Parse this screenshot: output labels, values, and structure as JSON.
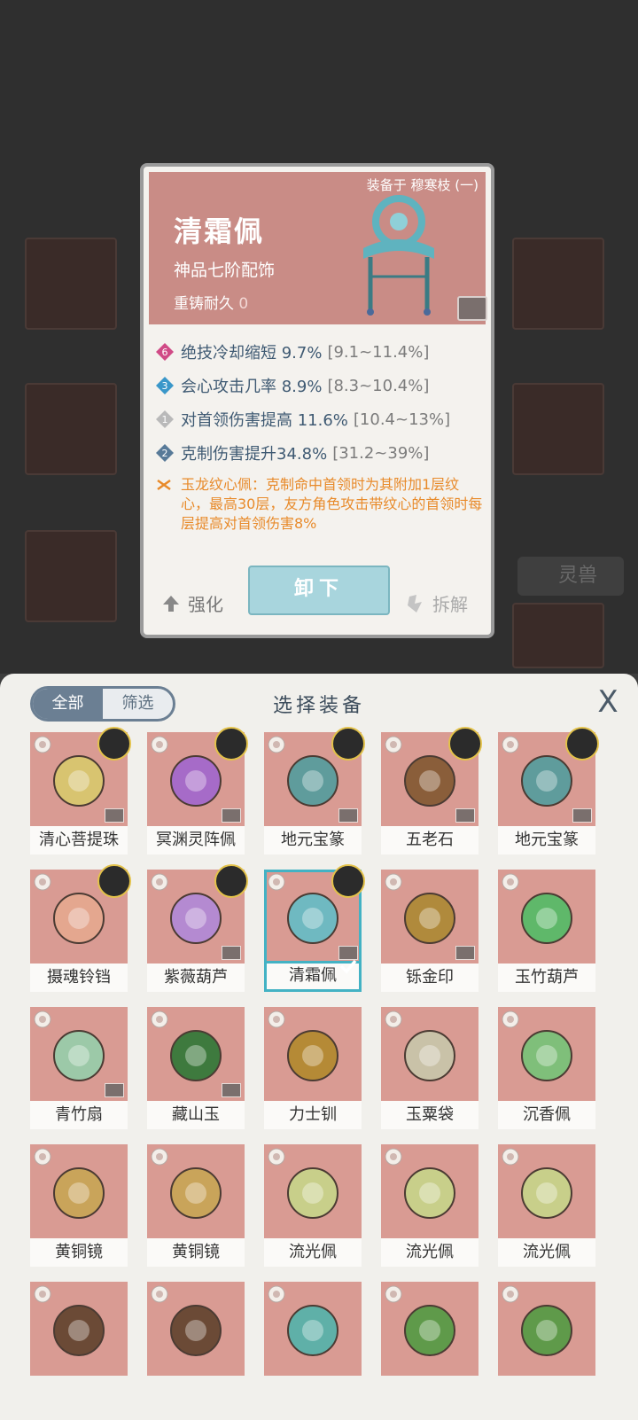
{
  "detail": {
    "equipped_on": "装备于 穆寒枝 (一)",
    "name": "清霜佩",
    "grade": "神品七阶配饰",
    "recast_label": "重铸耐久",
    "recast_value": "0",
    "stats": [
      {
        "badge": "6",
        "badge_color": "#d04a86",
        "text": "绝技冷却缩短 9.7%",
        "range": "[9.1~11.4%]"
      },
      {
        "badge": "3",
        "badge_color": "#3a97c9",
        "text": "会心攻击几率 8.9%",
        "range": "[8.3~10.4%]"
      },
      {
        "badge": "1",
        "badge_color": "#b9b9b9",
        "text": "对首领伤害提高 11.6%",
        "range": "[10.4~13%]"
      },
      {
        "badge": "2",
        "badge_color": "#587a98",
        "text": "克制伤害提升34.8%",
        "range": "[31.2~39%]"
      }
    ],
    "set_effect": "玉龙纹心佩：克制命中首领时为其附加1层纹心，最高30层，友方角色攻击带纹心的首领时每层提高对首领伤害8%",
    "strengthen_label": "强化",
    "unequip_label": "卸下",
    "dismantle_label": "拆解"
  },
  "background": {
    "tab_label": "灵兽"
  },
  "panel": {
    "tab_all": "全部",
    "tab_filter": "筛选",
    "title": "选择装备",
    "close_label": "X",
    "items": [
      {
        "name": "清心菩提珠",
        "color": "#d8c470",
        "avatar": true,
        "locked": true,
        "selected": false
      },
      {
        "name": "冥渊灵阵佩",
        "color": "#a66bc8",
        "avatar": true,
        "locked": true,
        "selected": false
      },
      {
        "name": "地元宝篆",
        "color": "#5f9c9c",
        "avatar": true,
        "locked": true,
        "selected": false
      },
      {
        "name": "五老石",
        "color": "#8a5e3a",
        "avatar": true,
        "locked": true,
        "selected": false
      },
      {
        "name": "地元宝篆",
        "color": "#5f9c9c",
        "avatar": true,
        "locked": true,
        "selected": false
      },
      {
        "name": "摄魂铃铛",
        "color": "#e4a78f",
        "avatar": true,
        "locked": false,
        "selected": false
      },
      {
        "name": "紫薇葫芦",
        "color": "#b48ad1",
        "avatar": true,
        "locked": true,
        "selected": false
      },
      {
        "name": "清霜佩",
        "color": "#6fb9c1",
        "avatar": true,
        "locked": true,
        "selected": true
      },
      {
        "name": "铄金印",
        "color": "#b08a3c",
        "avatar": false,
        "locked": true,
        "selected": false
      },
      {
        "name": "玉竹葫芦",
        "color": "#5fb86a",
        "avatar": false,
        "locked": false,
        "selected": false
      },
      {
        "name": "青竹扇",
        "color": "#9cc9a8",
        "avatar": false,
        "locked": true,
        "selected": false
      },
      {
        "name": "藏山玉",
        "color": "#3e7a3e",
        "avatar": false,
        "locked": true,
        "selected": false
      },
      {
        "name": "力士钏",
        "color": "#b58a36",
        "avatar": false,
        "locked": false,
        "selected": false
      },
      {
        "name": "玉粟袋",
        "color": "#c9c2a8",
        "avatar": false,
        "locked": false,
        "selected": false
      },
      {
        "name": "沉香佩",
        "color": "#7fbf7a",
        "avatar": false,
        "locked": false,
        "selected": false
      },
      {
        "name": "黄铜镜",
        "color": "#c9a45a",
        "avatar": false,
        "locked": false,
        "selected": false
      },
      {
        "name": "黄铜镜",
        "color": "#c9a45a",
        "avatar": false,
        "locked": false,
        "selected": false
      },
      {
        "name": "流光佩",
        "color": "#c8cf8a",
        "avatar": false,
        "locked": false,
        "selected": false
      },
      {
        "name": "流光佩",
        "color": "#c8cf8a",
        "avatar": false,
        "locked": false,
        "selected": false
      },
      {
        "name": "流光佩",
        "color": "#c8cf8a",
        "avatar": false,
        "locked": false,
        "selected": false
      },
      {
        "name": "",
        "color": "#6b4a36",
        "avatar": false,
        "locked": false,
        "selected": false
      },
      {
        "name": "",
        "color": "#6b4a36",
        "avatar": false,
        "locked": false,
        "selected": false
      },
      {
        "name": "",
        "color": "#5fb0a8",
        "avatar": false,
        "locked": false,
        "selected": false
      },
      {
        "name": "",
        "color": "#5f9a4a",
        "avatar": false,
        "locked": false,
        "selected": false
      },
      {
        "name": "",
        "color": "#5f9a4a",
        "avatar": false,
        "locked": false,
        "selected": false
      }
    ]
  },
  "colors": {
    "accent_selected": "#43b2c4",
    "set_effect": "#e88a2a",
    "tile_bg": "#d99b93"
  }
}
